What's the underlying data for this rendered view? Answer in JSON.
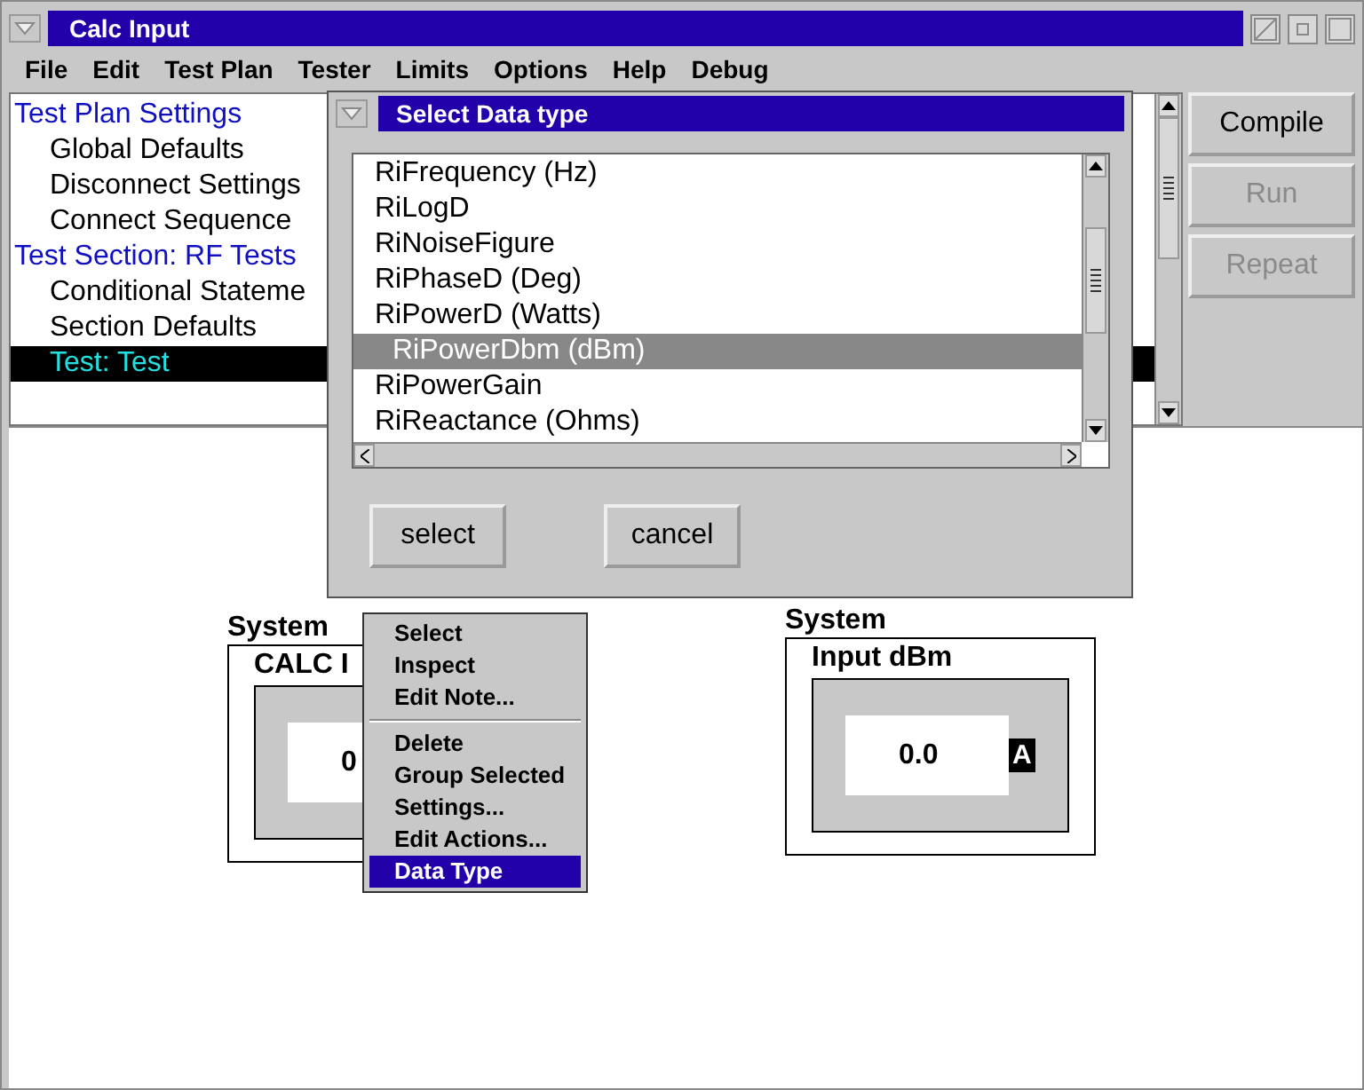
{
  "window": {
    "title": "Calc Input"
  },
  "menu": [
    "File",
    "Edit",
    "Test Plan",
    "Tester",
    "Limits",
    "Options",
    "Help",
    "Debug"
  ],
  "tree": [
    {
      "label": "Test Plan Settings",
      "selected": false,
      "children": [
        {
          "label": "Global Defaults",
          "selected": false
        },
        {
          "label": "Disconnect Settings",
          "selected": false
        },
        {
          "label": "Connect Sequence",
          "selected": false
        }
      ]
    },
    {
      "label": "Test Section: RF Tests",
      "selected": false,
      "children": [
        {
          "label": "Conditional Stateme",
          "selected": false
        },
        {
          "label": "Section Defaults",
          "selected": false
        },
        {
          "label": "Test: Test",
          "selected": true
        }
      ]
    }
  ],
  "buttons": [
    {
      "label": "Compile",
      "disabled": false
    },
    {
      "label": "Run",
      "disabled": true
    },
    {
      "label": "Repeat",
      "disabled": true
    }
  ],
  "dialog": {
    "title": "Select Data type",
    "items": [
      {
        "label": "RiFrequency (Hz)",
        "selected": false
      },
      {
        "label": "RiLogD",
        "selected": false
      },
      {
        "label": "RiNoiseFigure",
        "selected": false
      },
      {
        "label": "RiPhaseD (Deg)",
        "selected": false
      },
      {
        "label": "RiPowerD (Watts)",
        "selected": false
      },
      {
        "label": "RiPowerDbm (dBm)",
        "selected": true
      },
      {
        "label": "RiPowerGain",
        "selected": false
      },
      {
        "label": "RiReactance (Ohms)",
        "selected": false
      }
    ],
    "buttons": [
      "select",
      "cancel"
    ]
  },
  "canvas": {
    "objects": [
      {
        "group": "System",
        "name": "CALC I",
        "value": "0"
      },
      {
        "group": "System",
        "name": "Input dBm",
        "value": "0.0",
        "badge": "A"
      }
    ]
  },
  "context_menu": {
    "sections": [
      [
        {
          "label": "Select",
          "selected": false
        },
        {
          "label": "Inspect",
          "selected": false
        },
        {
          "label": "Edit Note...",
          "selected": false
        }
      ],
      [
        {
          "label": "Delete",
          "selected": false
        },
        {
          "label": "Group Selected",
          "selected": false
        },
        {
          "label": "Settings...",
          "selected": false
        },
        {
          "label": "Edit Actions...",
          "selected": false
        },
        {
          "label": "Data Type",
          "selected": true
        }
      ]
    ]
  }
}
